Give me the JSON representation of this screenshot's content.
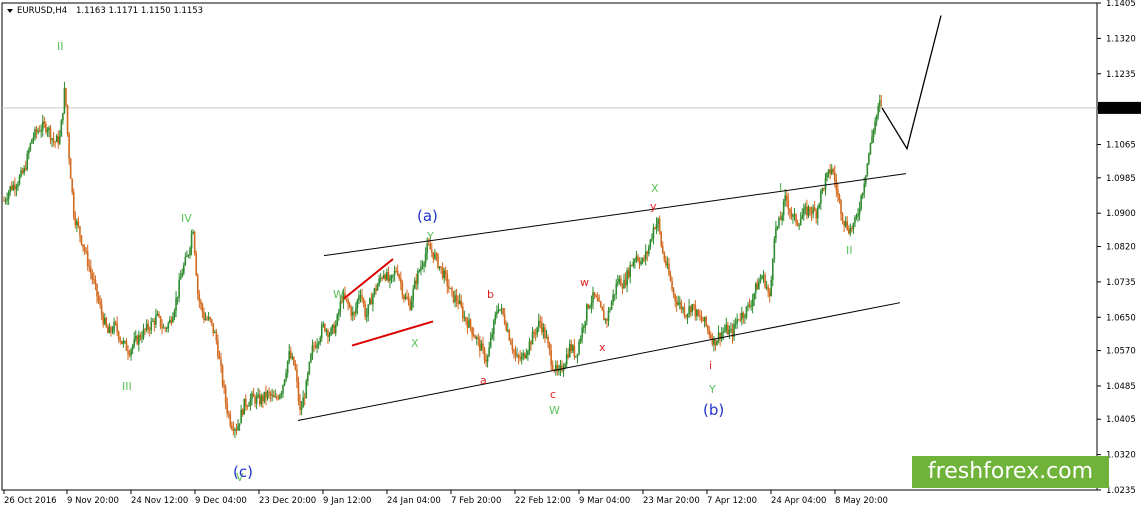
{
  "header": {
    "symbol": "EURUSD,H4",
    "ohlc": "1.1163 1.1171 1.1150 1.1153"
  },
  "watermark": {
    "text": "freshforex.com"
  },
  "colors": {
    "candle_up": "#2e8b2e",
    "candle_down": "#d2691e",
    "channel": "#000000",
    "triangle": "#dd0000",
    "label_green": "#5cc05c",
    "label_red": "#dd2222",
    "label_blue": "#2233cc",
    "current_bg": "#000000"
  },
  "chart_data": {
    "type": "candlestick",
    "symbol": "EURUSD",
    "timeframe": "H4",
    "ylim": [
      1.0235,
      1.1405
    ],
    "y_ticks": [
      "1.1405",
      "1.1320",
      "1.1235",
      "1.1153",
      "1.1065",
      "1.0985",
      "1.0900",
      "1.0820",
      "1.0735",
      "1.0650",
      "1.0570",
      "1.0485",
      "1.0405",
      "1.0320",
      "1.0235"
    ],
    "current_price": "1.1153",
    "x_ticks": [
      "26 Oct 2016",
      "9 Nov 20:00",
      "24 Nov 12:00",
      "9 Dec 04:00",
      "23 Dec 20:00",
      "9 Jan 12:00",
      "24 Jan 04:00",
      "7 Feb 20:00",
      "22 Feb 12:00",
      "9 Mar 04:00",
      "23 Mar 20:00",
      "7 Apr 12:00",
      "24 Apr 04:00",
      "8 May 20:00"
    ],
    "price_path": [
      [
        0,
        1.092
      ],
      [
        8,
        1.096
      ],
      [
        15,
        1.0975
      ],
      [
        22,
        1.1
      ],
      [
        30,
        1.108
      ],
      [
        38,
        1.1105
      ],
      [
        45,
        1.111
      ],
      [
        52,
        1.107
      ],
      [
        58,
        1.108
      ],
      [
        63,
        1.1205
      ],
      [
        66,
        1.107
      ],
      [
        72,
        1.0895
      ],
      [
        78,
        1.085
      ],
      [
        85,
        1.079
      ],
      [
        92,
        1.073
      ],
      [
        100,
        1.0655
      ],
      [
        106,
        1.061
      ],
      [
        113,
        1.063
      ],
      [
        120,
        1.059
      ],
      [
        127,
        1.057
      ],
      [
        133,
        1.059
      ],
      [
        140,
        1.061
      ],
      [
        148,
        1.063
      ],
      [
        155,
        1.065
      ],
      [
        162,
        1.062
      ],
      [
        168,
        1.064
      ],
      [
        174,
        1.069
      ],
      [
        180,
        1.076
      ],
      [
        186,
        1.08
      ],
      [
        191,
        1.087
      ],
      [
        196,
        1.07
      ],
      [
        202,
        1.065
      ],
      [
        208,
        1.064
      ],
      [
        214,
        1.06
      ],
      [
        219,
        1.052
      ],
      [
        224,
        1.044
      ],
      [
        229,
        1.0395
      ],
      [
        235,
        1.0385
      ],
      [
        242,
        1.044
      ],
      [
        250,
        1.0455
      ],
      [
        258,
        1.045
      ],
      [
        266,
        1.0465
      ],
      [
        273,
        1.045
      ],
      [
        280,
        1.048
      ],
      [
        287,
        1.056
      ],
      [
        293,
        1.053
      ],
      [
        298,
        1.042
      ],
      [
        304,
        1.048
      ],
      [
        310,
        1.057
      ],
      [
        316,
        1.06
      ],
      [
        322,
        1.063
      ],
      [
        328,
        1.061
      ],
      [
        334,
        1.063
      ],
      [
        340,
        1.07
      ],
      [
        346,
        1.068
      ],
      [
        352,
        1.065
      ],
      [
        358,
        1.072
      ],
      [
        364,
        1.065
      ],
      [
        370,
        1.07
      ],
      [
        376,
        1.073
      ],
      [
        382,
        1.076
      ],
      [
        388,
        1.073
      ],
      [
        395,
        1.077
      ],
      [
        402,
        1.07
      ],
      [
        408,
        1.068
      ],
      [
        414,
        1.074
      ],
      [
        420,
        1.078
      ],
      [
        426,
        1.082
      ],
      [
        432,
        1.08
      ],
      [
        438,
        1.077
      ],
      [
        444,
        1.074
      ],
      [
        450,
        1.07
      ],
      [
        456,
        1.069
      ],
      [
        462,
        1.065
      ],
      [
        468,
        1.063
      ],
      [
        474,
        1.06
      ],
      [
        480,
        1.057
      ],
      [
        485,
        1.0545
      ],
      [
        490,
        1.061
      ],
      [
        496,
        1.068
      ],
      [
        502,
        1.065
      ],
      [
        508,
        1.06
      ],
      [
        514,
        1.055
      ],
      [
        520,
        1.055
      ],
      [
        526,
        1.058
      ],
      [
        532,
        1.061
      ],
      [
        538,
        1.064
      ],
      [
        544,
        1.06
      ],
      [
        550,
        1.054
      ],
      [
        556,
        1.051
      ],
      [
        562,
        1.054
      ],
      [
        568,
        1.058
      ],
      [
        574,
        1.056
      ],
      [
        580,
        1.062
      ],
      [
        586,
        1.068
      ],
      [
        592,
        1.07
      ],
      [
        598,
        1.067
      ],
      [
        604,
        1.064
      ],
      [
        610,
        1.069
      ],
      [
        616,
        1.074
      ],
      [
        622,
        1.073
      ],
      [
        628,
        1.077
      ],
      [
        634,
        1.08
      ],
      [
        640,
        1.078
      ],
      [
        646,
        1.081
      ],
      [
        652,
        1.087
      ],
      [
        656,
        1.088
      ],
      [
        660,
        1.081
      ],
      [
        666,
        1.076
      ],
      [
        672,
        1.07
      ],
      [
        678,
        1.068
      ],
      [
        684,
        1.066
      ],
      [
        690,
        1.068
      ],
      [
        696,
        1.065
      ],
      [
        702,
        1.064
      ],
      [
        708,
        1.061
      ],
      [
        712,
        1.059
      ],
      [
        718,
        1.061
      ],
      [
        724,
        1.062
      ],
      [
        730,
        1.061
      ],
      [
        736,
        1.065
      ],
      [
        742,
        1.066
      ],
      [
        748,
        1.068
      ],
      [
        754,
        1.072
      ],
      [
        760,
        1.075
      ],
      [
        764,
        1.073
      ],
      [
        768,
        1.069
      ],
      [
        772,
        1.085
      ],
      [
        778,
        1.088
      ],
      [
        784,
        1.094
      ],
      [
        790,
        1.089
      ],
      [
        796,
        1.088
      ],
      [
        802,
        1.09
      ],
      [
        808,
        1.091
      ],
      [
        814,
        1.09
      ],
      [
        818,
        1.094
      ],
      [
        824,
        1.098
      ],
      [
        830,
        1.101
      ],
      [
        836,
        1.094
      ],
      [
        842,
        1.088
      ],
      [
        848,
        1.086
      ],
      [
        854,
        1.088
      ],
      [
        860,
        1.095
      ],
      [
        866,
        1.103
      ],
      [
        872,
        1.111
      ],
      [
        878,
        1.1165
      ],
      [
        881,
        1.1153
      ]
    ],
    "annotations": {
      "channel_lines": [
        {
          "points": [
            [
              "23 Dec 20:00",
              1.0402
            ],
            [
              "8 May 20:00",
              1.0685
            ]
          ]
        },
        {
          "points": [
            [
              "9 Jan 12:00",
              1.0798
            ],
            [
              "8 May 20:00",
              1.0995
            ]
          ]
        }
      ],
      "triangle_lines": [
        {
          "points": [
            [
              "9 Jan 12:00",
              1.0695
            ],
            [
              "24 Jan 04:00",
              1.079
            ]
          ]
        },
        {
          "points": [
            [
              "9 Jan 12:00",
              1.0582
            ],
            [
              "24 Jan 04:00",
              1.064
            ]
          ]
        }
      ],
      "projection": [
        [
          1.1153,
          1.1055,
          1.1375
        ]
      ],
      "wave_labels": [
        {
          "text": "II",
          "color": "green"
        },
        {
          "text": "IV",
          "color": "green"
        },
        {
          "text": "III",
          "color": "green"
        },
        {
          "text": "V",
          "color": "green"
        },
        {
          "text": "(c)",
          "color": "blue"
        },
        {
          "text": "(a)",
          "color": "blue"
        },
        {
          "text": "Y",
          "color": "green"
        },
        {
          "text": "W",
          "color": "green"
        },
        {
          "text": "X",
          "color": "green"
        },
        {
          "text": "b",
          "color": "red"
        },
        {
          "text": "a",
          "color": "red"
        },
        {
          "text": "c",
          "color": "red"
        },
        {
          "text": "W",
          "color": "green"
        },
        {
          "text": "w",
          "color": "red"
        },
        {
          "text": "x",
          "color": "red"
        },
        {
          "text": "X",
          "color": "green"
        },
        {
          "text": "y",
          "color": "red"
        },
        {
          "text": "i",
          "color": "red"
        },
        {
          "text": "Y",
          "color": "green"
        },
        {
          "text": "(b)",
          "color": "blue"
        },
        {
          "text": "I",
          "color": "green"
        },
        {
          "text": "II",
          "color": "green"
        }
      ]
    }
  }
}
